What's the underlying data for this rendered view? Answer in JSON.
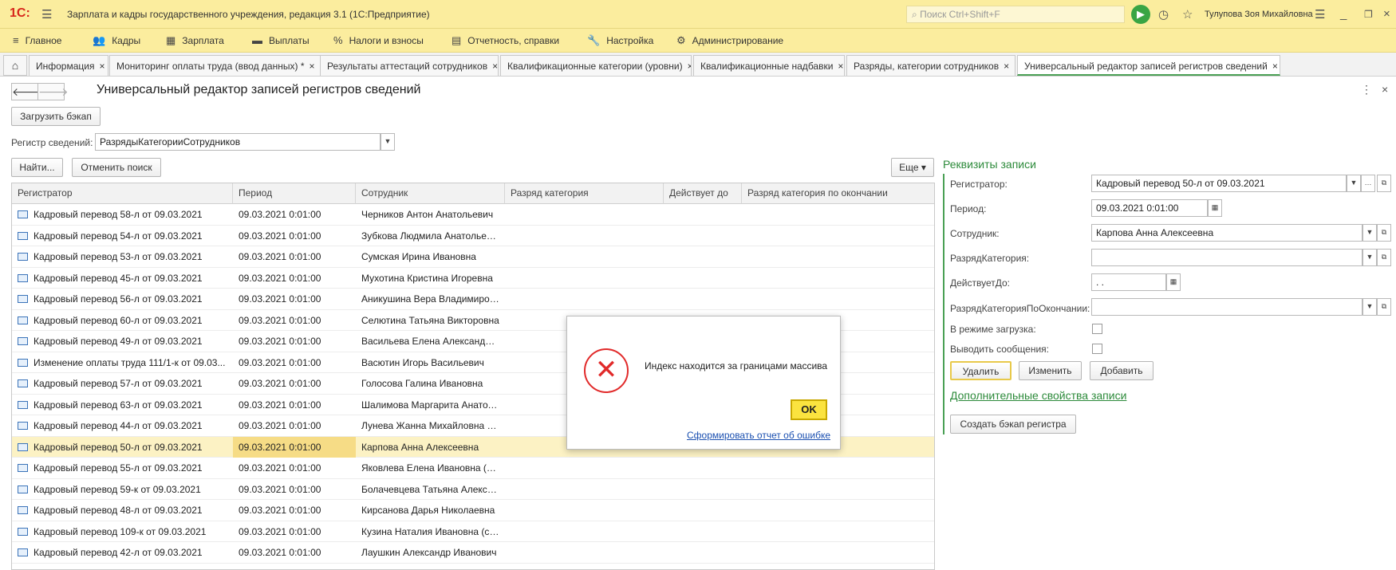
{
  "titlebar": {
    "logo": "1С:",
    "title": "Зарплата и кадры государственного учреждения, редакция 3.1  (1С:Предприятие)",
    "search_placeholder": "Поиск Ctrl+Shift+F",
    "user": "Тулупова Зоя Михайловна"
  },
  "menu": [
    {
      "icon": "≡",
      "label": "Главное"
    },
    {
      "icon": "👥",
      "label": "Кадры"
    },
    {
      "icon": "▦",
      "label": "Зарплата"
    },
    {
      "icon": "▬",
      "label": "Выплаты"
    },
    {
      "icon": "%",
      "label": "Налоги и взносы"
    },
    {
      "icon": "▤",
      "label": "Отчетность, справки"
    },
    {
      "icon": "🔧",
      "label": "Настройка"
    },
    {
      "icon": "⚙",
      "label": "Администрирование"
    }
  ],
  "tabs": [
    "Информация",
    "Мониторинг оплаты труда (ввод данных) *",
    "Результаты аттестаций сотрудников",
    "Квалификационные категории (уровни)",
    "Квалификационные надбавки",
    "Разряды, категории сотрудников",
    "Универсальный редактор записей регистров сведений"
  ],
  "form": {
    "title": "Универсальный редактор записей регистров сведений",
    "load_backup": "Загрузить бэкап",
    "register_label": "Регистр сведений:",
    "register_value": "РазрядыКатегорииСотрудников",
    "find": "Найти...",
    "cancel_search": "Отменить поиск",
    "more": "Еще"
  },
  "grid": {
    "headers": [
      "Регистратор",
      "Период",
      "Сотрудник",
      "Разряд категория",
      "Действует до",
      "Разряд категория по окончании"
    ],
    "rows": [
      {
        "reg": "Кадровый перевод 58-л от 09.03.2021",
        "period": "09.03.2021 0:01:00",
        "emp": "Черников Антон Анатольевич"
      },
      {
        "reg": "Кадровый перевод 54-л от 09.03.2021",
        "period": "09.03.2021 0:01:00",
        "emp": "Зубкова Людмила Анатольевна"
      },
      {
        "reg": "Кадровый перевод 53-л от 09.03.2021",
        "period": "09.03.2021 0:01:00",
        "emp": "Сумская Ирина Ивановна"
      },
      {
        "reg": "Кадровый перевод 45-л от 09.03.2021",
        "period": "09.03.2021 0:01:00",
        "emp": "Мухотина Кристина Игоревна"
      },
      {
        "reg": "Кадровый перевод 56-л от 09.03.2021",
        "period": "09.03.2021 0:01:00",
        "emp": "Аникушина Вера Владимировна"
      },
      {
        "reg": "Кадровый перевод 60-л от 09.03.2021",
        "period": "09.03.2021 0:01:00",
        "emp": "Селютина Татьяна Викторовна"
      },
      {
        "reg": "Кадровый перевод 49-л от 09.03.2021",
        "period": "09.03.2021 0:01:00",
        "emp": "Васильева Елена Александро..."
      },
      {
        "reg": "Изменение оплаты труда 111/1-к от 09.03...",
        "period": "09.03.2021 0:01:00",
        "emp": "Васютин Игорь Васильевич"
      },
      {
        "reg": "Кадровый перевод 57-л от 09.03.2021",
        "period": "09.03.2021 0:01:00",
        "emp": "Голосова Галина Ивановна"
      },
      {
        "reg": "Кадровый перевод 63-л от 09.03.2021",
        "period": "09.03.2021 0:01:00",
        "emp": "Шалимова Маргарита Анатоль..."
      },
      {
        "reg": "Кадровый перевод 44-л от 09.03.2021",
        "period": "09.03.2021 0:01:00",
        "emp": "Лунева Жанна Михайловна (о..."
      },
      {
        "reg": "Кадровый перевод 50-л от 09.03.2021",
        "period": "09.03.2021 0:01:00",
        "emp": "Карпова Анна Алексеевна"
      },
      {
        "reg": "Кадровый перевод 55-л от 09.03.2021",
        "period": "09.03.2021 0:01:00",
        "emp": "Яковлева Елена Ивановна (осн)"
      },
      {
        "reg": "Кадровый перевод 59-к от 09.03.2021",
        "period": "09.03.2021 0:01:00",
        "emp": "Болачевцева Татьяна Алекса..."
      },
      {
        "reg": "Кадровый перевод 48-л от 09.03.2021",
        "period": "09.03.2021 0:01:00",
        "emp": "Кирсанова Дарья Николаевна"
      },
      {
        "reg": "Кадровый перевод 109-к от 09.03.2021",
        "period": "09.03.2021 0:01:00",
        "emp": "Кузина Наталия Ивановна (со..."
      },
      {
        "reg": "Кадровый перевод 42-л от 09.03.2021",
        "period": "09.03.2021 0:01:00",
        "emp": "Лаушкин Александр Иванович"
      }
    ]
  },
  "record": {
    "title": "Реквизиты записи",
    "registrator_label": "Регистратор:",
    "registrator_value": "Кадровый перевод 50-л от 09.03.2021",
    "period_label": "Период:",
    "period_value": "09.03.2021  0:01:00",
    "employee_label": "Сотрудник:",
    "employee_value": "Карпова Анна Алексеевна",
    "category_label": "РазрядКатегория:",
    "valid_label": "ДействуетДо:",
    "valid_value": " .  .",
    "category_end_label": "РазрядКатегорияПоОкончании:",
    "load_mode_label": "В режиме загрузка:",
    "show_msg_label": "Выводить сообщения:",
    "delete": "Удалить",
    "change": "Изменить",
    "add": "Добавить",
    "extra_props": "Дополнительные свойства записи",
    "backup": "Создать бэкап регистра"
  },
  "dialog": {
    "message": "Индекс находится за границами массива",
    "ok": "OK",
    "report_link": "Сформировать отчет об ошибке"
  }
}
